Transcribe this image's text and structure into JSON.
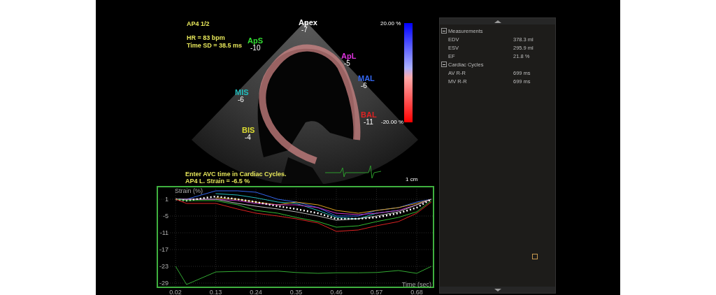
{
  "echo": {
    "view_label": "AP4  1/2",
    "heart_rate": "HR = 83 bpm",
    "time_sd": "Time SD = 38.5 ms",
    "instruction": "Enter AVC time in Cardiac Cycles.",
    "global_strain": "AP4 L. Strain = -6.5 %",
    "scale_max": "20.00 %",
    "scale_min": "-20.00 %",
    "depth_marker": "1 cm",
    "segments": [
      {
        "label": "Apex",
        "value": "-7",
        "color": "#ffffff"
      },
      {
        "label": "ApS",
        "value": "-10",
        "color": "#33dd33"
      },
      {
        "label": "ApL",
        "value": "-5",
        "color": "#dd33dd"
      },
      {
        "label": "MAL",
        "value": "-6",
        "color": "#3366ee"
      },
      {
        "label": "MIS",
        "value": "-6",
        "color": "#22bbbb"
      },
      {
        "label": "BAL",
        "value": "-11",
        "color": "#dd2222"
      },
      {
        "label": "BIS",
        "value": "-4",
        "color": "#dddd33"
      }
    ]
  },
  "strain_chart": {
    "chart_data": {
      "type": "line",
      "xlabel": "Time (sec)",
      "ylabel": "Strain (%)",
      "x": [
        0.02,
        0.05,
        0.13,
        0.19,
        0.24,
        0.3,
        0.35,
        0.41,
        0.46,
        0.52,
        0.57,
        0.63,
        0.68,
        0.72
      ],
      "xlim": [
        -0.03,
        0.726
      ],
      "grid": true,
      "ylim": [
        -30.5,
        5.5
      ],
      "xticks": [
        0.02,
        0.13,
        0.24,
        0.35,
        0.46,
        0.57,
        0.68
      ],
      "yticks": [
        1,
        -5,
        -11,
        -17,
        -23,
        -29
      ],
      "series": [
        {
          "color": "#3366ee",
          "line_style": "solid",
          "values": [
            1,
            1,
            4,
            4,
            3.5,
            1,
            0,
            -2,
            -5,
            -5,
            -3,
            -2,
            0,
            1
          ]
        },
        {
          "color": "#22bbbb",
          "line_style": "solid",
          "values": [
            null,
            null,
            3,
            2.5,
            1.5,
            0,
            -0.5,
            -3,
            -5.5,
            -6,
            -4,
            -3,
            null,
            null
          ]
        },
        {
          "color": "#d9a020",
          "line_style": "solid",
          "values": [
            null,
            null,
            1.5,
            1,
            0,
            -1,
            0,
            -1,
            -3,
            -4,
            -3,
            -2,
            -0.5,
            1
          ]
        },
        {
          "color": "#cc33cc",
          "line_style": "solid",
          "values": [
            1,
            1,
            1,
            0.5,
            -0.5,
            -1,
            -1,
            -2,
            -4,
            -4.5,
            -4,
            -3,
            -1,
            1
          ]
        },
        {
          "color": "#bbbbbb",
          "line_style": "solid",
          "values": [
            1,
            1,
            1,
            -0.5,
            -1.5,
            -2.5,
            -3.5,
            -5,
            -6.5,
            -6,
            -5,
            -3.5,
            -1,
            1
          ]
        },
        {
          "color": "#ffffff",
          "line_style": "dotted",
          "values": [
            1,
            0.5,
            2,
            1,
            0,
            -1.5,
            -2.5,
            -4,
            -6,
            -6,
            -5.5,
            -4,
            -2,
            1
          ]
        },
        {
          "color": "#33bb33",
          "line_style": "solid",
          "values": [
            1,
            0.5,
            0.5,
            -1,
            -3,
            -4,
            -5.5,
            -7,
            -9,
            -8.5,
            -7,
            -5.5,
            -3.5,
            0.5
          ]
        },
        {
          "color": "#dd2222",
          "line_style": "solid",
          "values": [
            1,
            -0.5,
            -0.5,
            -2.5,
            -4,
            -5,
            -6,
            -7.5,
            -10.5,
            -10,
            -8.5,
            -7,
            -4,
            0
          ]
        },
        {
          "color": "#33aa33",
          "line_style": "solid",
          "values": [
            -23,
            -29.5,
            -25,
            -24.8,
            -24.8,
            -24.7,
            -25.2,
            -25.5,
            -25.3,
            -25.3,
            -25.2,
            -24.5,
            -25.5,
            -23
          ]
        }
      ]
    }
  },
  "panel": {
    "groups": [
      {
        "title": "Measurements",
        "expanded": true,
        "rows": [
          {
            "label": "EDV",
            "value": "378.3 ml"
          },
          {
            "label": "ESV",
            "value": "295.9 ml"
          },
          {
            "label": "EF",
            "value": "21.8 %"
          }
        ]
      },
      {
        "title": "Cardiac Cycles",
        "expanded": true,
        "rows": [
          {
            "label": "AV R-R",
            "value": "699 ms"
          },
          {
            "label": "MV R-R",
            "value": "699 ms"
          }
        ]
      }
    ]
  }
}
